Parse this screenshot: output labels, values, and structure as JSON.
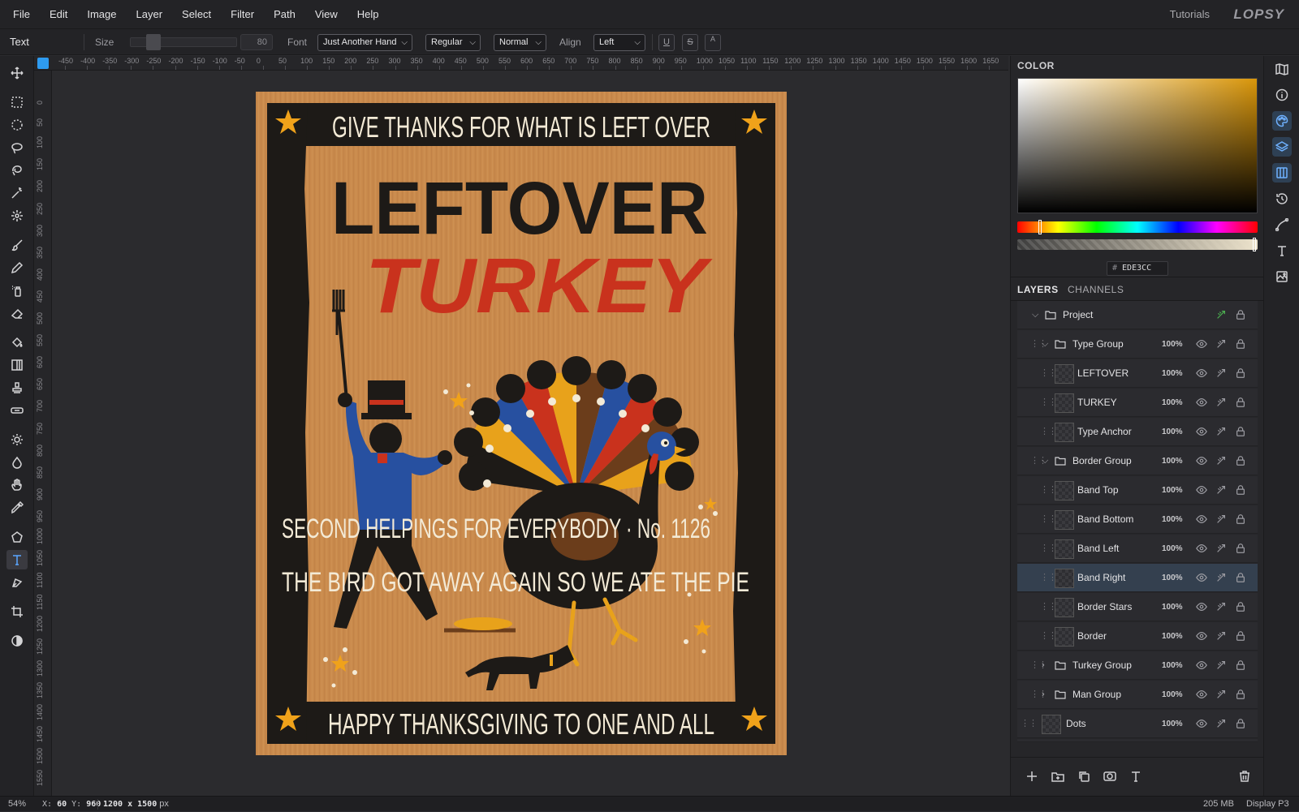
{
  "menubar": {
    "items": [
      "File",
      "Edit",
      "Image",
      "Layer",
      "Select",
      "Filter",
      "Path",
      "View",
      "Help"
    ],
    "tutorials": "Tutorials",
    "logo": "LOPSY"
  },
  "options": {
    "tool_name": "Text",
    "size_label": "Size",
    "size_value": "80",
    "font_label": "Font",
    "font_value": "Just Another Hand",
    "style_value": "Regular",
    "blend_value": "Normal",
    "align_label": "Align",
    "align_value": "Left",
    "underline_glyph": "U",
    "strike_glyph": "S",
    "case_glyph": "A"
  },
  "ruler": {
    "top": [
      "-450",
      "-400",
      "-350",
      "-300",
      "-250",
      "-200",
      "-150",
      "-100",
      "-50",
      "0",
      "50",
      "100",
      "150",
      "200",
      "250",
      "300",
      "350",
      "400",
      "450",
      "500",
      "550",
      "600",
      "650",
      "700",
      "750",
      "800",
      "850",
      "900",
      "950",
      "1000",
      "1050",
      "1100",
      "1150",
      "1200",
      "1250",
      "1300",
      "1350",
      "1400",
      "1450",
      "1500",
      "1550",
      "1600",
      "1650"
    ],
    "left": [
      "0",
      "50",
      "100",
      "150",
      "200",
      "250",
      "300",
      "350",
      "400",
      "450",
      "500",
      "550",
      "600",
      "650",
      "700",
      "750",
      "800",
      "850",
      "900",
      "950",
      "1000",
      "1050",
      "1100",
      "1150",
      "1200",
      "1250",
      "1300",
      "1350",
      "1400",
      "1450",
      "1500",
      "1550"
    ]
  },
  "artwork": {
    "top_banner": "GIVE THANKS FOR WHAT IS LEFT OVER",
    "title_line1": "LEFTOVER",
    "title_line2": "TURKEY",
    "line1": "SECOND HELPINGS FOR EVERYBODY · No. 1126",
    "line2": "THE BIRD GOT AWAY AGAIN SO WE ATE THE PIE",
    "bottom_banner": "HAPPY THANKSGIVING TO ONE AND ALL",
    "colors": {
      "paper": "#c98a4c",
      "frame": "#1d1a17",
      "cream": "#f3ead6",
      "red": "#c9321d",
      "blue": "#2750a0",
      "gold": "#e8a21b",
      "brown": "#6b3d1b"
    }
  },
  "color_panel": {
    "title": "COLOR",
    "hex_prefix": "#",
    "hex": "EDE3CC",
    "swatch": "#EDE3CC"
  },
  "layers_panel": {
    "tabs": [
      "LAYERS",
      "CHANNELS"
    ],
    "rows": [
      {
        "name": "Project",
        "opacity": "",
        "kind": "folder",
        "indent": 0,
        "expanded": true
      },
      {
        "name": "Type Group",
        "opacity": "100%",
        "kind": "folder",
        "indent": 1,
        "expanded": true
      },
      {
        "name": "LEFTOVER",
        "opacity": "100%",
        "kind": "layer",
        "indent": 2
      },
      {
        "name": "TURKEY",
        "opacity": "100%",
        "kind": "layer",
        "indent": 2
      },
      {
        "name": "Type Anchor",
        "opacity": "100%",
        "kind": "layer",
        "indent": 2
      },
      {
        "name": "Border Group",
        "opacity": "100%",
        "kind": "folder",
        "indent": 1,
        "expanded": true
      },
      {
        "name": "Band Top",
        "opacity": "100%",
        "kind": "layer",
        "indent": 2
      },
      {
        "name": "Band Bottom",
        "opacity": "100%",
        "kind": "layer",
        "indent": 2
      },
      {
        "name": "Band Left",
        "opacity": "100%",
        "kind": "layer",
        "indent": 2
      },
      {
        "name": "Band Right",
        "opacity": "100%",
        "kind": "layer",
        "indent": 2,
        "selected": true
      },
      {
        "name": "Border Stars",
        "opacity": "100%",
        "kind": "layer",
        "indent": 2
      },
      {
        "name": "Border",
        "opacity": "100%",
        "kind": "layer",
        "indent": 2
      },
      {
        "name": "Turkey Group",
        "opacity": "100%",
        "kind": "folder",
        "indent": 1,
        "expanded": false
      },
      {
        "name": "Man Group",
        "opacity": "100%",
        "kind": "folder",
        "indent": 1,
        "expanded": false
      },
      {
        "name": "Dots",
        "opacity": "100%",
        "kind": "layer",
        "indent": 0
      }
    ]
  },
  "status": {
    "zoom": "54%",
    "x_label": "X:",
    "x": "60",
    "y_label": "Y:",
    "y": "960",
    "dimensions": "1200 x 1500",
    "unit": "px",
    "memory": "205 MB",
    "color_profile": "Display P3"
  }
}
